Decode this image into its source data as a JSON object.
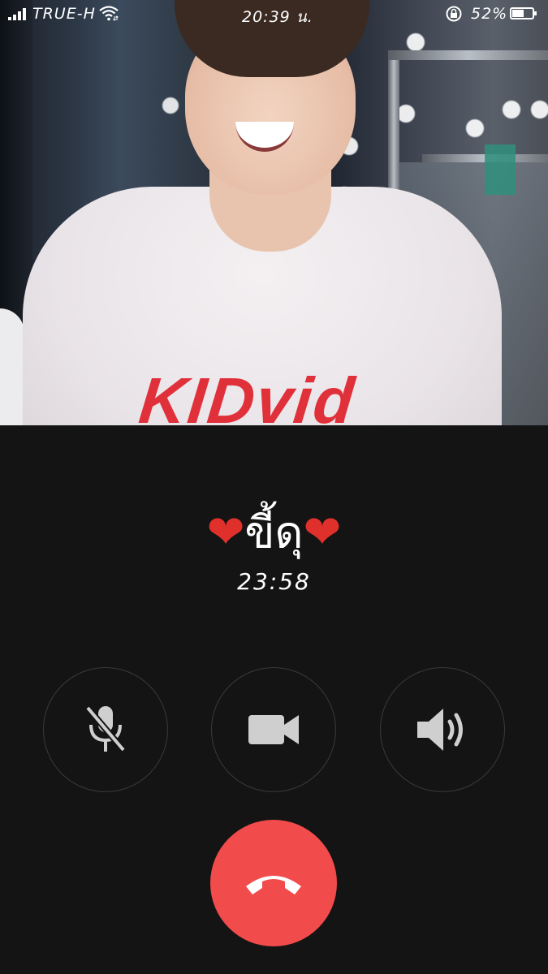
{
  "status_bar": {
    "carrier": "TRUE-H",
    "time": "20:39 น.",
    "battery_percent": "52%",
    "battery_level": 0.52,
    "icons": [
      "signal-icon",
      "wifi-icon",
      "rotation-lock-icon",
      "battery-icon"
    ]
  },
  "call": {
    "caller_name": "ขี้ดุ",
    "heart_left": "❤",
    "heart_right": "❤",
    "duration": "23:58"
  },
  "controls": [
    {
      "name": "mute",
      "icon": "microphone-muted-icon"
    },
    {
      "name": "video",
      "icon": "video-camera-icon"
    },
    {
      "name": "speaker",
      "icon": "speaker-icon"
    }
  ],
  "hangup": {
    "icon": "phone-hangup-icon"
  },
  "colors": {
    "background": "#141414",
    "hangup": "#f24b4b",
    "heart": "#e0302c",
    "icon": "#cfcfcf"
  },
  "photo": {
    "shirt_text": "KIDvid"
  }
}
